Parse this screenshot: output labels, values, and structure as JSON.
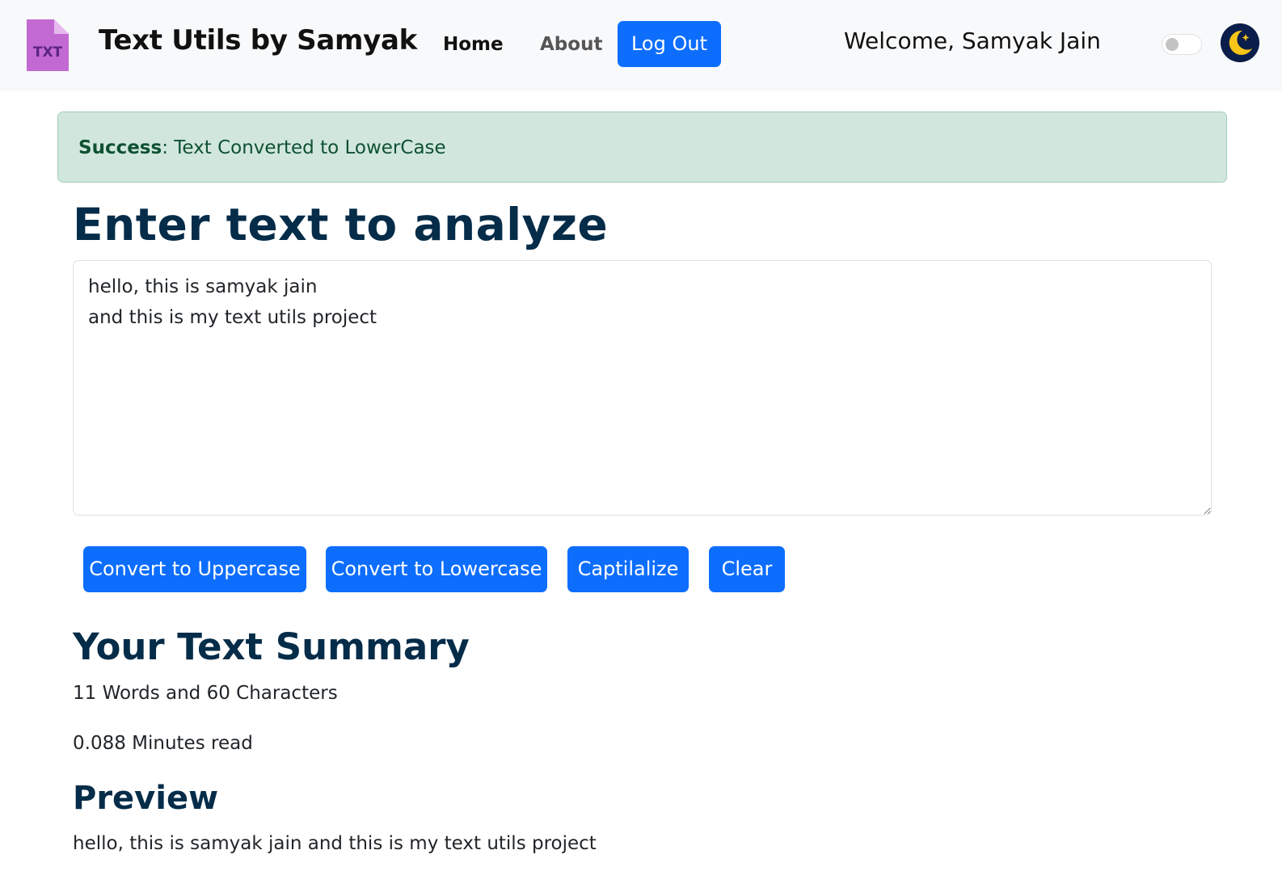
{
  "navbar": {
    "logo_text": "TXT",
    "brand": "Text Utils by Samyak",
    "links": [
      {
        "label": "Home"
      },
      {
        "label": "About"
      }
    ],
    "logout_label": "Log Out",
    "welcome": "Welcome, Samyak Jain",
    "dark_mode_enabled": false
  },
  "alert": {
    "type": "Success",
    "message": ": Text Converted to LowerCase",
    "color": "#d1e7dd"
  },
  "main": {
    "heading": "Enter text to analyze",
    "textarea_value": "hello, this is samyak jain\nand this is my text utils project",
    "buttons": [
      {
        "label": "Convert to Uppercase"
      },
      {
        "label": "Convert to Lowercase"
      },
      {
        "label": "Captilalize"
      },
      {
        "label": "Clear"
      }
    ],
    "accent_color": "#0d6efd"
  },
  "summary": {
    "heading": "Your Text Summary",
    "counts": "11 Words and 60 Characters",
    "read_time": "0.088 Minutes read"
  },
  "preview": {
    "heading": "Preview",
    "text": "hello, this is samyak jain and this is my text utils project"
  }
}
